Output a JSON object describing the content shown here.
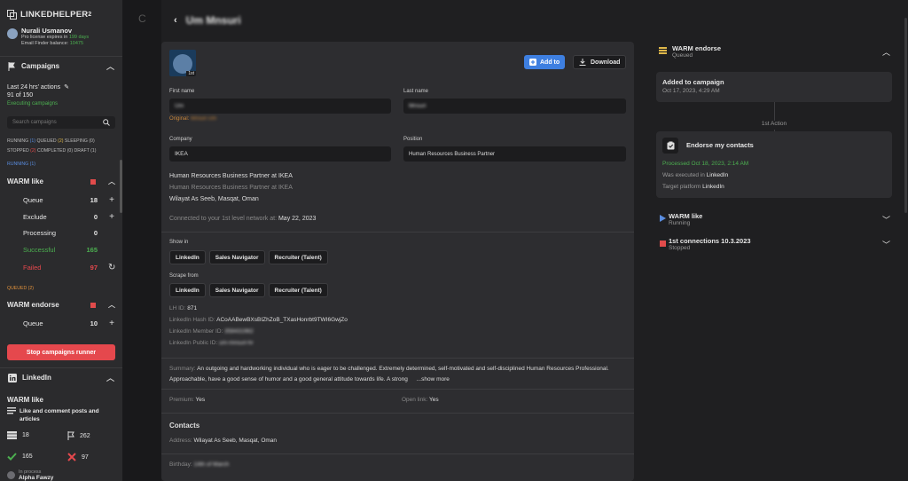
{
  "sidebar": {
    "brand": "LINKEDHELPER",
    "brand_sup": "2",
    "user": {
      "name": "Nurali Usmanov",
      "license_prefix": "Pro license expires in",
      "license_days": "199 days",
      "finder_label": "Email Finder balance:",
      "finder_value": "10475"
    },
    "campaigns_header": "Campaigns",
    "actions_label": "Last 24 hrs' actions",
    "actions_count": "91 of 150",
    "executing": "Executing campaigns",
    "search_placeholder": "Search campaigns",
    "stats_line1": {
      "running": "RUNNING",
      "running_n": "(1)",
      "queued": "QUEUED",
      "queued_n": "(2)",
      "sleeping": "SLEEPING",
      "sleeping_n": "(0)"
    },
    "stats_line2": {
      "stopped": "STOPPED",
      "stopped_n": "(2)",
      "completed": "COMPLETED",
      "completed_n": "(0)",
      "draft": "DRAFT",
      "draft_n": "(1)"
    },
    "running_label": "RUNNING (1)",
    "campaign1": {
      "name": "WARM like",
      "rows": [
        {
          "label": "Queue",
          "value": "18",
          "action": "+"
        },
        {
          "label": "Exclude",
          "value": "0",
          "action": "+"
        },
        {
          "label": "Processing",
          "value": "0",
          "action": ""
        },
        {
          "label": "Successful",
          "value": "165",
          "action": ""
        },
        {
          "label": "Failed",
          "value": "97",
          "action": "↻"
        }
      ]
    },
    "queued_label": "QUEUED (2)",
    "campaign2": {
      "name": "WARM endorse",
      "rows": [
        {
          "label": "Queue",
          "value": "10",
          "action": "+"
        }
      ]
    },
    "stop_button": "Stop campaigns runner",
    "linkedin_header": "LinkedIn",
    "lk_campaign": "WARM like",
    "lk_desc": "Like and comment posts and articles",
    "lk_stats": {
      "queue": "18",
      "flag": "262",
      "ok": "165",
      "fail": "97"
    },
    "lk_inprocess": "In process",
    "lk_person": "Alpha Fawzy",
    "colors": {
      "accent_red": "#e5484d",
      "success": "#4caf50",
      "link_blue": "#5a8de0"
    }
  },
  "gap": {
    "c": "C"
  },
  "main": {
    "title": "Um Mnsuri",
    "profile": {
      "degree": "1st",
      "add_to": "Add to",
      "download": "Download",
      "first_name_label": "First name",
      "first_name": "Um",
      "original_label": "Original:",
      "original_value": "Mnsuri Um",
      "last_name_label": "Last name",
      "last_name": "Mnsuri",
      "company_label": "Company",
      "company": "IKEA",
      "position_label": "Position",
      "position": "Human Resources Business Partner",
      "headline": "Human Resources Business Partner at IKEA",
      "headline2": "Human Resources Business Partner at IKEA",
      "location": "Wilayat As Seeb, Masqat, Oman",
      "connected_label": "Connected to your 1st level network at:",
      "connected_date": "May 22, 2023",
      "show_in_label": "Show in",
      "show_in": [
        "LinkedIn",
        "Sales Navigator",
        "Recruiter (Talent)"
      ],
      "scrape_from_label": "Scrape from",
      "scrape_from": [
        "LinkedIn",
        "Sales Navigator",
        "Recruiter (Talent)"
      ],
      "lh_id_label": "LH ID:",
      "lh_id": "871",
      "hash_label": "LinkedIn Hash ID:",
      "hash": "ACoAABewBXsBIZhZoB_TXasHonrbt9TWI6GwjZo",
      "member_label": "LinkedIn Member ID:",
      "member": "358431962",
      "public_label": "LinkedIn Public ID:",
      "public": "um-mnsuri-hr",
      "summary_label": "Summary:",
      "summary": "An outgoing and hardworking individual who is eager to be challenged. Extremely determined, self-motivated and self-disciplined Human Resources Professional. Approachable, have a good sense of humor and a good general attitude towards life. A strong",
      "show_more": "...show more",
      "premium_label": "Premium:",
      "premium": "Yes",
      "open_label": "Open link:",
      "open": "Yes",
      "contacts_title": "Contacts",
      "address_label": "Address:",
      "address": "Wilayat As Seeb, Masqat, Oman",
      "birthday_label": "Birthday:",
      "birthday": "14th of March"
    }
  },
  "right": {
    "camp1": {
      "name": "WARM endorse",
      "status": "Queued"
    },
    "added_title": "Added to campaign",
    "added_date": "Oct 17, 2023, 4:29 AM",
    "action_label": "1st Action",
    "action": {
      "title": "Endorse my contacts",
      "processed": "Processed Oct 18, 2023, 2:14 AM",
      "exec_label": "Was executed in",
      "exec_value": "LinkedIn",
      "target_label": "Target platform",
      "target_value": "LinkedIn"
    },
    "camp2": {
      "name": "WARM like",
      "status": "Running"
    },
    "camp3": {
      "name": "1st connections 10.3.2023",
      "status": "Stopped"
    },
    "colors": {
      "running": "#5a8de0",
      "stopped": "#e14b4b",
      "processed": "#4caf50",
      "queued": "#e0b84a"
    }
  }
}
